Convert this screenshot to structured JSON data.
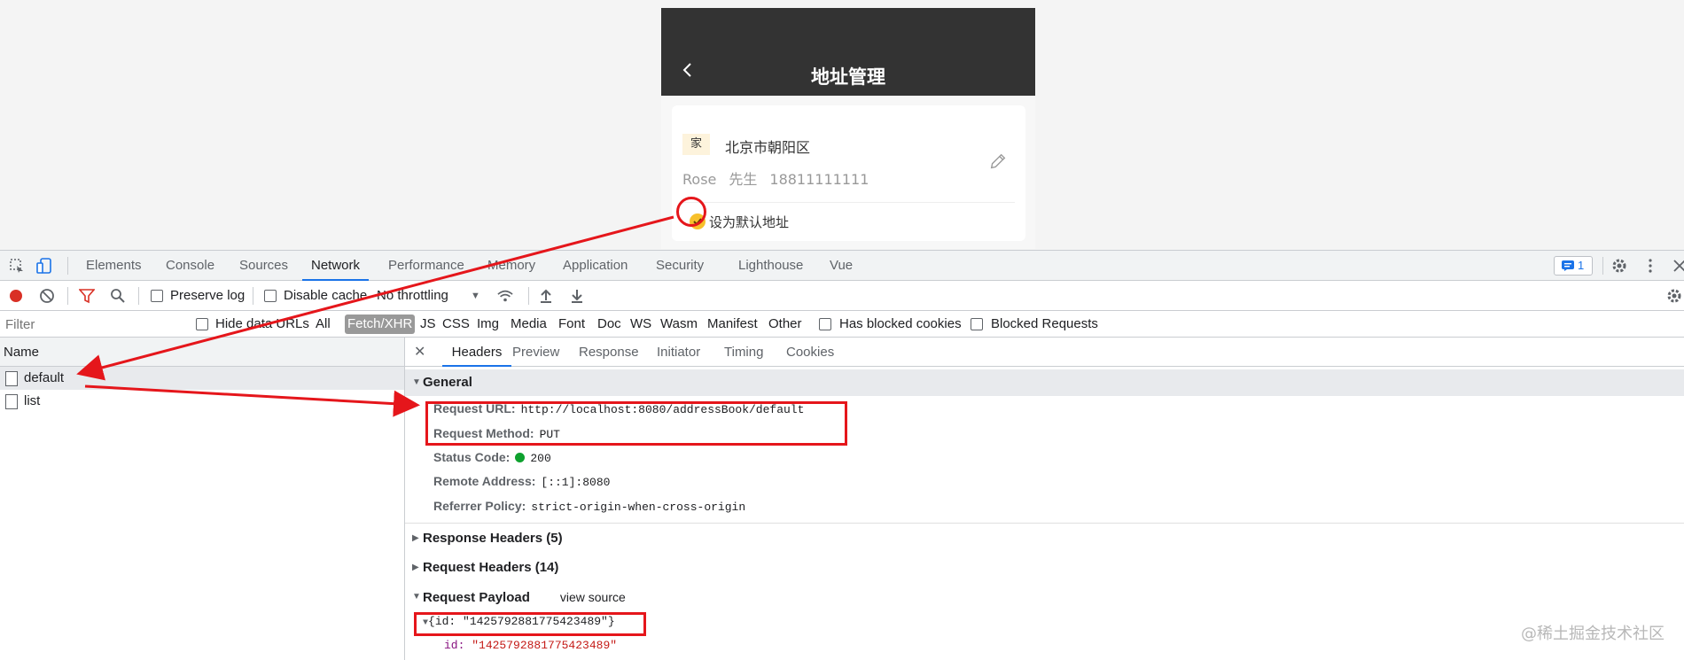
{
  "phone": {
    "title": "地址管理",
    "address": {
      "tag": "家",
      "detail": "北京市朝阳区",
      "contact_name": "Rose",
      "contact_gender": "先生",
      "phone": "18811111111",
      "default_label": "设为默认地址"
    },
    "colors": {
      "header": "#333333",
      "check": "#f7c02b",
      "tag_bg": "#fdf3dc"
    }
  },
  "devtools": {
    "tabs": [
      "Elements",
      "Console",
      "Sources",
      "Network",
      "Performance",
      "Memory",
      "Application",
      "Security",
      "Lighthouse",
      "Vue"
    ],
    "active_tab": "Network",
    "issues_count": "1",
    "toolbar": {
      "preserve_log": "Preserve log",
      "disable_cache": "Disable cache",
      "throttling": "No throttling"
    },
    "filter": {
      "placeholder": "Filter",
      "hide_data_urls": "Hide data URLs",
      "types": [
        "All",
        "Fetch/XHR",
        "JS",
        "CSS",
        "Img",
        "Media",
        "Font",
        "Doc",
        "WS",
        "Wasm",
        "Manifest",
        "Other"
      ],
      "active_type": "Fetch/XHR",
      "has_blocked_cookies": "Has blocked cookies",
      "blocked_requests": "Blocked Requests"
    },
    "requests": {
      "header": "Name",
      "items": [
        "default",
        "list"
      ],
      "selected": "default"
    },
    "detail": {
      "tabs": [
        "Headers",
        "Preview",
        "Response",
        "Initiator",
        "Timing",
        "Cookies"
      ],
      "active_tab": "Headers",
      "general": {
        "title": "General",
        "request_url_label": "Request URL:",
        "request_url": "http://localhost:8080/addressBook/default",
        "request_method_label": "Request Method:",
        "request_method": "PUT",
        "status_code_label": "Status Code:",
        "status_code": "200",
        "remote_address_label": "Remote Address:",
        "remote_address": "[::1]:8080",
        "referrer_policy_label": "Referrer Policy:",
        "referrer_policy": "strict-origin-when-cross-origin"
      },
      "response_headers": "Response Headers (5)",
      "request_headers": "Request Headers (14)",
      "payload": {
        "title": "Request Payload",
        "view_source": "view source",
        "summary": "{id: \"1425792881775423489\"}",
        "id_key": "id:",
        "id_value": "\"1425792881775423489\""
      }
    }
  },
  "watermark": "@稀土掘金技术社区",
  "annotation_color": "#e5161b"
}
